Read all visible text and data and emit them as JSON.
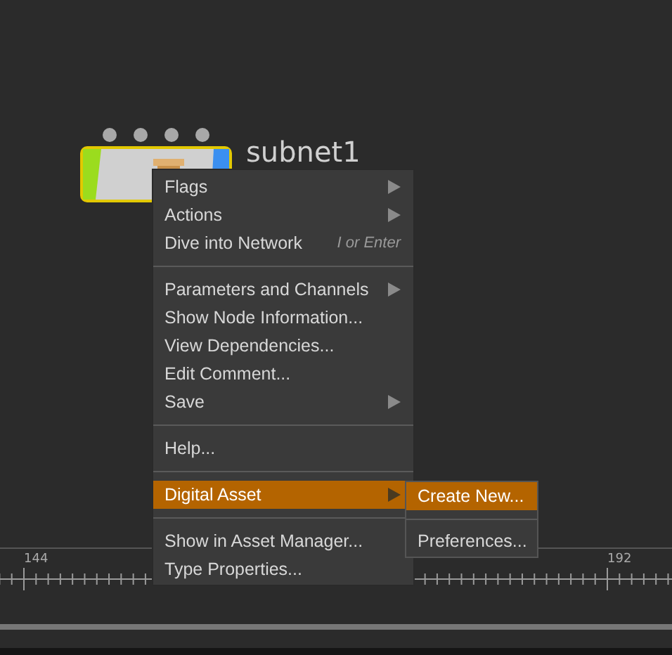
{
  "node": {
    "name": "subnet1",
    "selected": true
  },
  "menu": {
    "groups": [
      [
        {
          "label": "Flags",
          "submenu": true,
          "selected": false
        },
        {
          "label": "Actions",
          "submenu": true,
          "selected": false
        },
        {
          "label": "Dive into Network",
          "shortcut": "I or Enter",
          "submenu": false,
          "selected": false
        }
      ],
      [
        {
          "label": "Parameters and Channels",
          "submenu": true,
          "selected": false
        },
        {
          "label": "Show Node Information...",
          "submenu": false,
          "selected": false
        },
        {
          "label": "View Dependencies...",
          "submenu": false,
          "selected": false
        },
        {
          "label": "Edit Comment...",
          "submenu": false,
          "selected": false
        },
        {
          "label": "Save",
          "submenu": true,
          "selected": false
        }
      ],
      [
        {
          "label": "Help...",
          "submenu": false,
          "selected": false
        }
      ],
      [
        {
          "label": "Digital Asset",
          "submenu": true,
          "selected": true
        }
      ],
      [
        {
          "label": "Show in Asset Manager...",
          "submenu": false,
          "selected": false
        },
        {
          "label": "Type Properties...",
          "submenu": false,
          "selected": false
        }
      ]
    ]
  },
  "submenu": {
    "groups": [
      [
        {
          "label": "Create New...",
          "selected": true
        }
      ],
      [
        {
          "label": "Preferences...",
          "selected": false
        }
      ]
    ]
  },
  "timeline": {
    "start_label": "144",
    "end_label": "192"
  }
}
